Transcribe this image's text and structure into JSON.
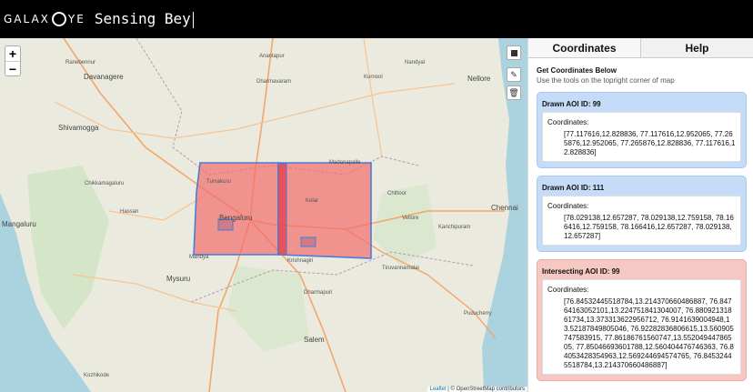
{
  "header": {
    "logo_text_left": "GALAX",
    "logo_text_right": "YE",
    "title": "Sensing Bey"
  },
  "map": {
    "zoom_in": "+",
    "zoom_out": "−",
    "attribution_leaflet": "Leaflet",
    "attribution_rest": " | © OpenStreetMap contributors",
    "places": {
      "anantapur": "Anantapur",
      "davanagere": "Davanagere",
      "kurnool": "Kurnool",
      "nandyal": "Nandyal",
      "nellore": "Nellore",
      "shivamogga": "Shivamogga",
      "chikkamagaluru": "Chikkamagaluru",
      "hassan": "Hassan",
      "mangaluru": "Mangaluru",
      "tumakuru": "Tumakuru",
      "bengaluru": "Bengaluru",
      "kolar": "Kolar",
      "madanapalle": "Madanapalle",
      "chittoor": "Chittoor",
      "chennai": "Chennai",
      "vellore": "Vellore",
      "kanchipuram": "Kanchipuram",
      "mandya": "Mandya",
      "mysuru": "Mysuru",
      "krishnagiri": "Krishnagiri",
      "dharmapuri": "Dharmapuri",
      "salem": "Salem",
      "puducherry": "Puducherry",
      "kozhikode": "Kozhikode",
      "dharmavaram": "Dharmavaram",
      "ranebennur": "Ranebennur",
      "tiruvannamalai": "Tiruvannamalai"
    },
    "colors": {
      "aoi_fill": "#f26d6b",
      "aoi_stroke": "#4a7bd8",
      "intersect_fill": "#e84a55",
      "sea": "#aad3df",
      "land": "#eaeadf"
    }
  },
  "panel": {
    "tabs": [
      "Coordinates",
      "Help"
    ],
    "heading": "Get Coordinates Below",
    "subheading": "Use the tools on the topright corner of map",
    "cards": [
      {
        "title": "Drawn AOI ID: 99",
        "label": "Coordinates:",
        "value": "[77.117616,12.828836, 77.117616,12.952065, 77.265876,12.952065, 77.265876,12.828836, 77.117616,12.828836]"
      },
      {
        "title": "Drawn AOI ID: 111",
        "label": "Coordinates:",
        "value": "[78.029138,12.657287, 78.029138,12.759158, 78.166416,12.759158, 78.166416,12.657287, 78.029138,12.657287]"
      },
      {
        "title": "Intersecting AOI ID: 99",
        "label": "Coordinates:",
        "value": "[76.84532445518784,13.214370660486887, 76.84764163052101,13.224751841304007, 76.88092131861734,13.373313622956712, 76.9141639004948,13.52187849805046, 76.92282836806615,13.560905747583915, 77.86186761560747,13.55204944786505, 77.85046693601788,12.560404476746363, 76.84053428354963,12.569244694574765, 76.84532445518784,13.214370660486887]"
      }
    ]
  }
}
